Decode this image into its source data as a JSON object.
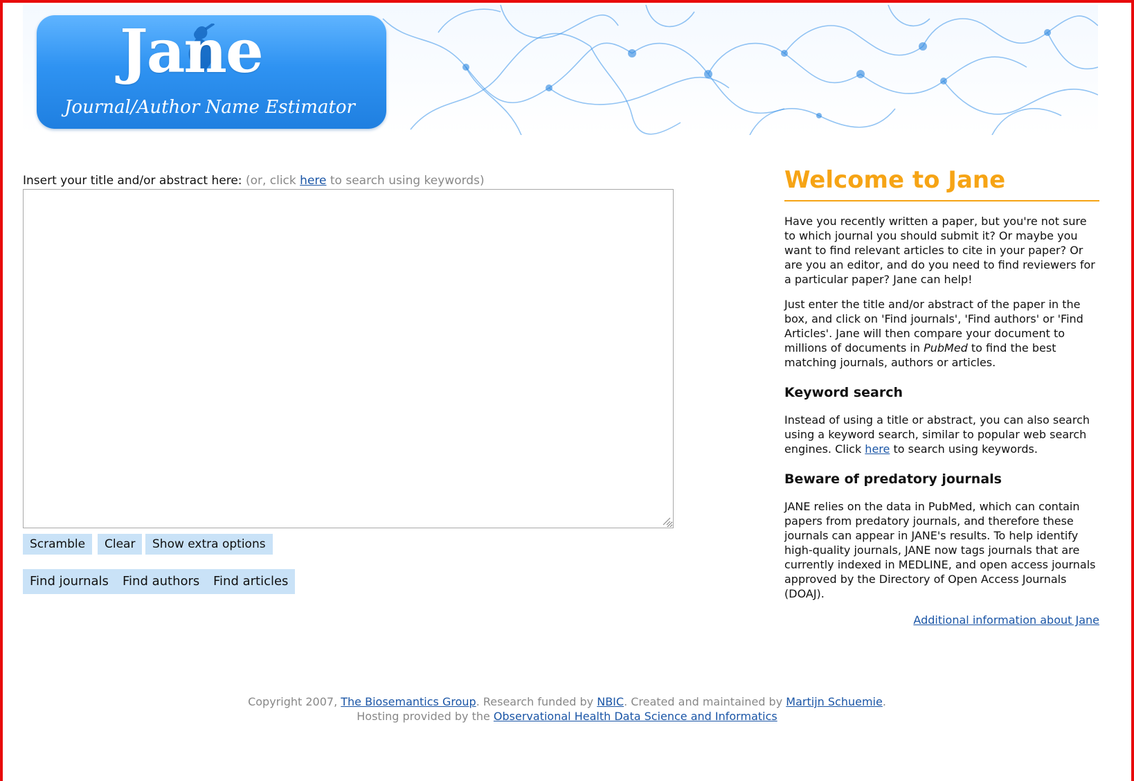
{
  "logo": {
    "title": "Jane",
    "subtitle": "Journal/Author Name Estimator"
  },
  "input": {
    "label": "Insert your title and/or abstract here:",
    "hint_prefix": "(or, click",
    "hint_link": "here",
    "hint_suffix": "to search using keywords)",
    "value": ""
  },
  "buttons": {
    "scramble": "Scramble",
    "clear": "Clear",
    "show_extra": "Show extra options",
    "find_journals": "Find journals",
    "find_authors": "Find authors",
    "find_articles": "Find articles"
  },
  "sidebar": {
    "welcome_title": "Welcome to Jane",
    "intro": "Have you recently written a paper, but you're not sure to which journal you should submit it? Or maybe you want to find relevant articles to cite in your paper? Or are you an editor, and do you need to find reviewers for a particular paper? Jane can help!",
    "instructions_before": "Just enter the title and/or abstract of the paper in the box, and click on 'Find journals', 'Find authors' or 'Find Articles'. Jane will then compare your document to millions of documents in",
    "instructions_em": "PubMed",
    "instructions_after": "to find the best matching journals, authors or articles.",
    "keyword_heading": "Keyword search",
    "keyword_before": "Instead of using a title or abstract, you can also search using a keyword search, similar to popular web search engines. Click",
    "keyword_link": "here",
    "keyword_after": "to search using keywords.",
    "predatory_heading": "Beware of predatory journals",
    "predatory_text": "JANE relies on the data in PubMed, which can contain papers from predatory journals, and therefore these journals can appear in JANE's results. To help identify high-quality journals, JANE now tags journals that are currently indexed in MEDLINE, and open access journals approved by the Directory of Open Access Journals (DOAJ).",
    "additional_link": "Additional information about Jane"
  },
  "footer": {
    "copyright": "Copyright 2007,",
    "group_link": "The Biosemantics Group",
    "funded": ". Research funded by",
    "nbic_link": "NBIC",
    "created": ". Created and maintained by",
    "author_link": "Martijn Schuemie",
    "period": ".",
    "hosting": "Hosting provided by the",
    "ohdsi_link": "Observational Health Data Science and Informatics"
  },
  "colors": {
    "accent": "#f6a415",
    "button_bg": "#c9e2f7",
    "link": "#1a55a6",
    "frame": "#e8090b",
    "logo_blue": "#2f93f2"
  }
}
